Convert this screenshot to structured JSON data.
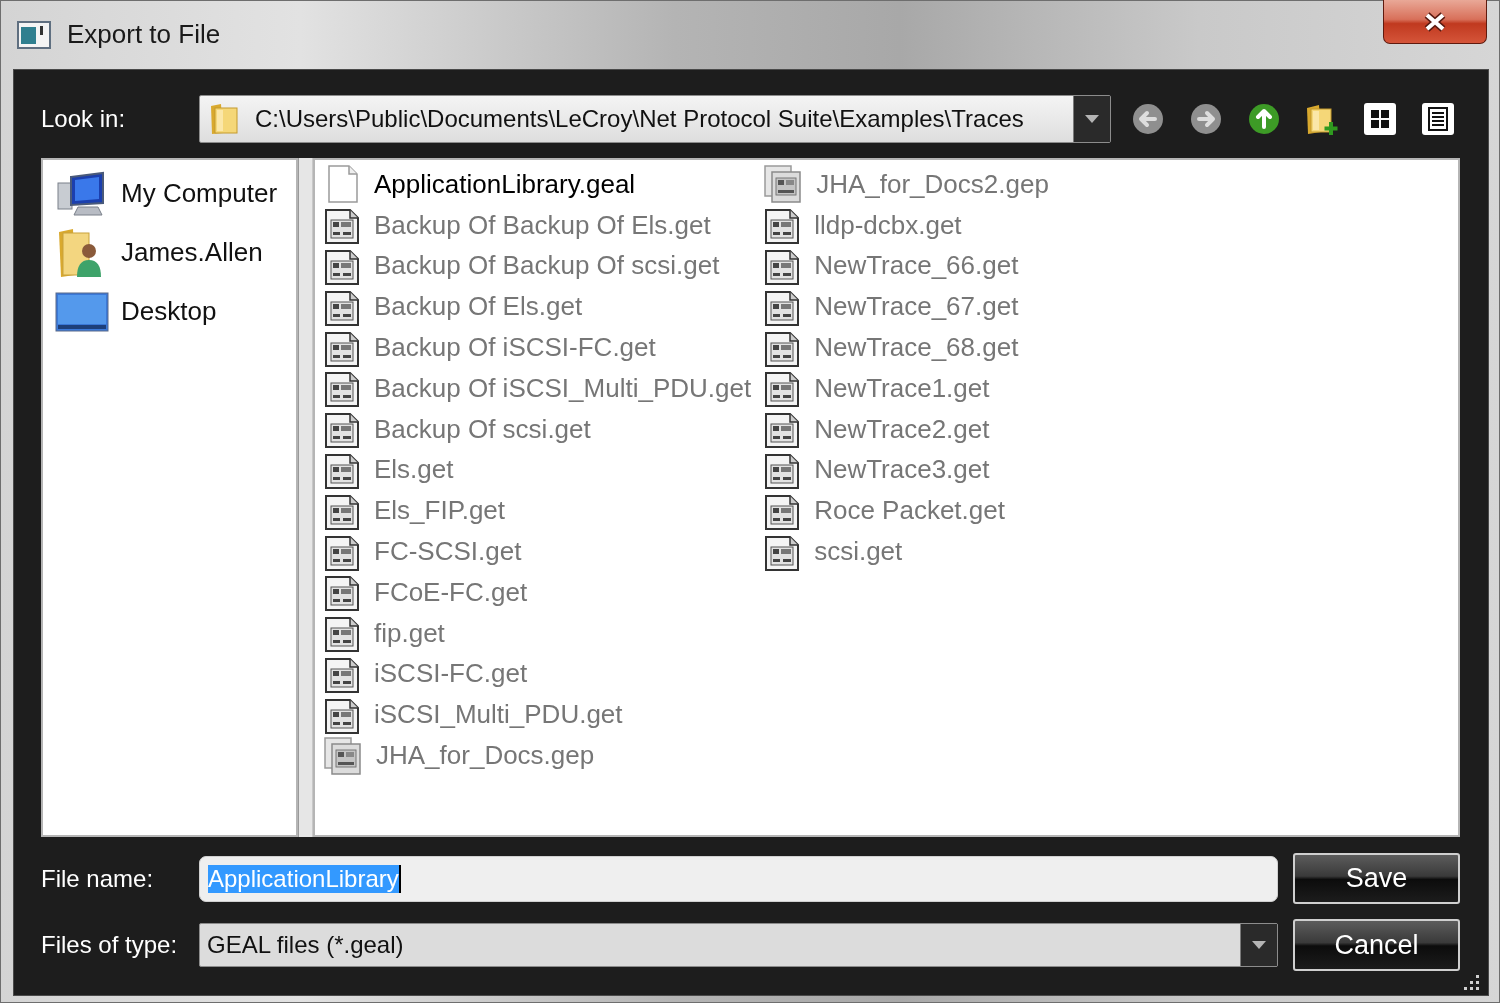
{
  "window": {
    "title": "Export to File"
  },
  "look_in": {
    "label": "Look in:",
    "path": "C:\\Users\\Public\\Documents\\LeCroy\\Net Protocol Suite\\Examples\\Traces"
  },
  "toolbar": [
    {
      "kind": "back",
      "disabled": true
    },
    {
      "kind": "forward",
      "disabled": true
    },
    {
      "kind": "up",
      "disabled": false
    },
    {
      "kind": "new_folder",
      "disabled": false
    },
    {
      "kind": "list_view",
      "disabled": false
    },
    {
      "kind": "detail_view",
      "disabled": false
    }
  ],
  "sidebar": {
    "items": [
      {
        "kind": "computer",
        "label": "My Computer",
        "selected": false
      },
      {
        "kind": "user_folder",
        "label": "James.Allen",
        "selected": false
      },
      {
        "kind": "desktop",
        "label": "Desktop",
        "selected": false
      }
    ]
  },
  "files": [
    {
      "kind": "blank",
      "name": "ApplicationLibrary.geal",
      "disabled": false,
      "selected": false
    },
    {
      "kind": "trace",
      "name": "Backup Of Backup Of Els.get",
      "disabled": true,
      "selected": false
    },
    {
      "kind": "trace",
      "name": "Backup Of Backup Of scsi.get",
      "disabled": true,
      "selected": false
    },
    {
      "kind": "trace",
      "name": "Backup Of Els.get",
      "disabled": true,
      "selected": false
    },
    {
      "kind": "trace",
      "name": "Backup Of iSCSI-FC.get",
      "disabled": true,
      "selected": false
    },
    {
      "kind": "trace",
      "name": "Backup Of iSCSI_Multi_PDU.get",
      "disabled": true,
      "selected": false
    },
    {
      "kind": "trace",
      "name": "Backup Of scsi.get",
      "disabled": true,
      "selected": false
    },
    {
      "kind": "trace",
      "name": "Els.get",
      "disabled": true,
      "selected": false
    },
    {
      "kind": "trace",
      "name": "Els_FIP.get",
      "disabled": true,
      "selected": false
    },
    {
      "kind": "trace",
      "name": "FC-SCSI.get",
      "disabled": true,
      "selected": false
    },
    {
      "kind": "trace",
      "name": "FCoE-FC.get",
      "disabled": true,
      "selected": false
    },
    {
      "kind": "trace",
      "name": "fip.get",
      "disabled": true,
      "selected": false
    },
    {
      "kind": "trace",
      "name": "iSCSI-FC.get",
      "disabled": true,
      "selected": false
    },
    {
      "kind": "trace",
      "name": "iSCSI_Multi_PDU.get",
      "disabled": true,
      "selected": false
    },
    {
      "kind": "project",
      "name": "JHA_for_Docs.gep",
      "disabled": true,
      "selected": false
    },
    {
      "kind": "project",
      "name": "JHA_for_Docs2.gep",
      "disabled": true,
      "selected": false
    },
    {
      "kind": "trace",
      "name": "lldp-dcbx.get",
      "disabled": true,
      "selected": false
    },
    {
      "kind": "trace",
      "name": "NewTrace_66.get",
      "disabled": true,
      "selected": false
    },
    {
      "kind": "trace",
      "name": "NewTrace_67.get",
      "disabled": true,
      "selected": false
    },
    {
      "kind": "trace",
      "name": "NewTrace_68.get",
      "disabled": true,
      "selected": false
    },
    {
      "kind": "trace",
      "name": "NewTrace1.get",
      "disabled": true,
      "selected": false
    },
    {
      "kind": "trace",
      "name": "NewTrace2.get",
      "disabled": true,
      "selected": false
    },
    {
      "kind": "trace",
      "name": "NewTrace3.get",
      "disabled": true,
      "selected": false
    },
    {
      "kind": "trace",
      "name": "Roce Packet.get",
      "disabled": true,
      "selected": false
    },
    {
      "kind": "trace",
      "name": "scsi.get",
      "disabled": true,
      "selected": false
    }
  ],
  "file_name": {
    "label": "File name:",
    "value": "ApplicationLibrary",
    "value_selected": true
  },
  "file_type": {
    "label": "Files of type:",
    "value": "GEAL files (*.geal)"
  },
  "buttons": [
    "Save",
    "Cancel"
  ]
}
